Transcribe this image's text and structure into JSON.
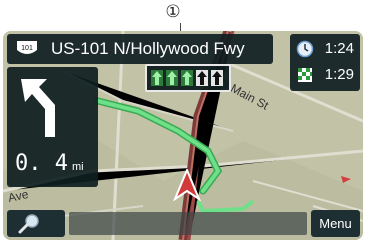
{
  "callout": {
    "marker": "①"
  },
  "street_bar": {
    "route_shield_number": "101",
    "street_name": "US-101 N/Hollywood Fwy"
  },
  "turn_panel": {
    "icon": "turn-left-arrow-icon",
    "distance_value": "0. 4",
    "distance_unit": "mi"
  },
  "lane_guidance": {
    "lanes": [
      "green-up-arrow",
      "green-up-arrow",
      "green-up-arrow",
      "black-up-arrow",
      "black-up-arrow"
    ]
  },
  "time_panel": {
    "current_time": "1:24",
    "arrival_time": "1:29"
  },
  "map": {
    "street_labels": [
      "N Main St",
      "Ave"
    ]
  },
  "bottom_bar": {
    "search_icon": "magnifier-icon",
    "menu_label": "Menu"
  },
  "colors": {
    "route": "#4fd06a",
    "lane_active": "#3dbb5a",
    "lane_inactive": "#1a1a1a",
    "panel": "#10202a",
    "map_base": "#bfbfa2"
  }
}
